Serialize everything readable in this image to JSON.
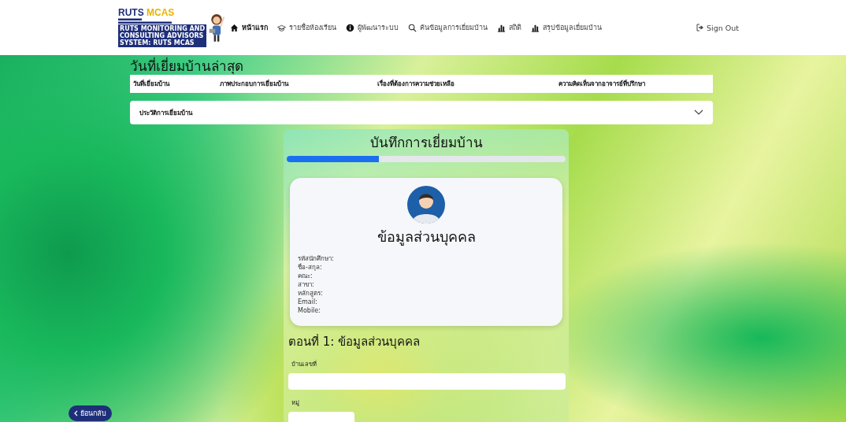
{
  "logo": {
    "title_left": "RUTS",
    "title_right": "MCAS",
    "lines": [
      "RUTS MONITORING AND",
      "CONSULTING ADVISORS",
      "SYSTEM: RUTS MCAS"
    ]
  },
  "nav": [
    {
      "label": "หน้าแรก",
      "selected": true
    },
    {
      "label": "รายชื่อห้องเรียน",
      "selected": false
    },
    {
      "label": "ผู้พัฒนาระบบ",
      "selected": false
    },
    {
      "label": "ค้นข้อมูลการเยี่ยมบ้าน",
      "selected": false
    },
    {
      "label": "สถิติ",
      "selected": false
    },
    {
      "label": "สรุปข้อมูลเยี่ยมบ้าน",
      "selected": false
    }
  ],
  "sign_out": "Sign Out",
  "latest_heading": "วันที่เยี่ยมบ้านล่าสุด",
  "table_columns": [
    "วันที่เยี่ยมบ้าน",
    "ภาพประกอบการเยี่ยมบ้าน",
    "เรื่องที่ต้องการความช่วยเหลือ",
    "ความคิดเห็นจากอาจารย์ที่ปรึกษา"
  ],
  "history": {
    "label": "ประวัติการเยี่ยมบ้าน",
    "expanded": false
  },
  "form": {
    "title": "บันทึกการเยี่ยมบ้าน",
    "level": 0.33,
    "profile": {
      "title": "ข้อมูลส่วนบุคคล",
      "fields": [
        "รหัสนักศึกษา:",
        "ชื่อ-สกุล:",
        "คณะ:",
        "สาขา:",
        "หลักสูตร:",
        "Email:",
        "Mobile:"
      ]
    },
    "section_title": "ตอนที่ 1: ข้อมูลส่วนบุคคล",
    "inputs": [
      {
        "label": "บ้านเลขที่"
      },
      {
        "label": "หมู่"
      }
    ]
  },
  "back_button": "ย้อนกลับ"
}
